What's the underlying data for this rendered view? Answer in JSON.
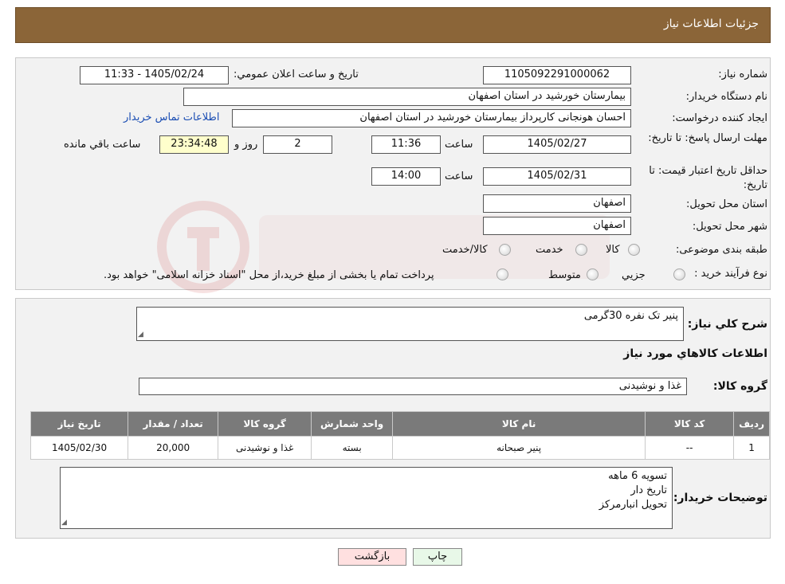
{
  "header": {
    "title": "جزئیات اطلاعات نیاز"
  },
  "labels": {
    "need_number": "شماره نیاز:",
    "announce_datetime": "تاریخ و ساعت اعلان عمومي:",
    "buyer_org": "نام دستگاه خریدار:",
    "requester": "ایجاد کننده درخواست:",
    "buyer_contact": "اطلاعات تماس خریدار",
    "reply_deadline": "مهلت ارسال پاسخ: تا تاریخ:",
    "time": "ساعت",
    "days_and": "روز و",
    "remaining": "ساعت باقي مانده",
    "price_validity": "حداقل تاریخ اعتبار قیمت: تا تاریخ:",
    "delivery_province": "استان محل تحویل:",
    "delivery_city": "شهر محل تحویل:",
    "category": "طبقه بندی موضوعی:",
    "purchase_type": "نوع فرآیند خرید :",
    "description": "شرح کلي نیاز:",
    "goods_info": "اطلاعات کالاهاي مورد نیاز",
    "goods_group": "گروه کالا:",
    "buyer_notes": "توضیحات خریدار:"
  },
  "fields": {
    "need_number": "1105092291000062",
    "announce_datetime": "1405/02/24 - 11:33",
    "buyer_org": "بیمارستان خورشید در استان اصفهان",
    "requester": "احسان هونجانی کارپرداز بیمارستان خورشید در استان اصفهان",
    "reply_date": "1405/02/27",
    "reply_time": "11:36",
    "days": "2",
    "remaining_time": "23:34:48",
    "validity_date": "1405/02/31",
    "validity_time": "14:00",
    "delivery_province": "اصفهان",
    "delivery_city": "اصفهان",
    "description": "پنیر تک نفره 30گرمی",
    "goods_group": "غذا و نوشیدنی",
    "buyer_notes_lines": [
      "تسویه 6 ماهه",
      "تاریخ دار",
      "تحویل انبارمرکز"
    ]
  },
  "category_options": [
    "کالا",
    "خدمت",
    "کالا/خدمت"
  ],
  "purchase_options": [
    "جزیي",
    "متوسط"
  ],
  "purchase_note": "پرداخت تمام یا بخشی از مبلغ خرید،از محل \"اسناد خزانه اسلامی\" خواهد بود.",
  "table": {
    "headers": [
      "ردیف",
      "کد کالا",
      "نام کالا",
      "واحد شمارش",
      "گروه کالا",
      "تعداد / مقدار",
      "تاریخ نیاز"
    ],
    "rows": [
      [
        "1",
        "--",
        "پنیر صبحانه",
        "بسته",
        "غذا و نوشیدنی",
        "20,000",
        "1405/02/30"
      ]
    ]
  },
  "buttons": {
    "print": "چاپ",
    "back": "بازگشت"
  },
  "colors": {
    "header": "#8b6538",
    "table_header": "#7a7a7a",
    "back_button": "#ffe0e0",
    "print_button": "#e8f8e8",
    "remaining_box": "#ffffcc"
  }
}
